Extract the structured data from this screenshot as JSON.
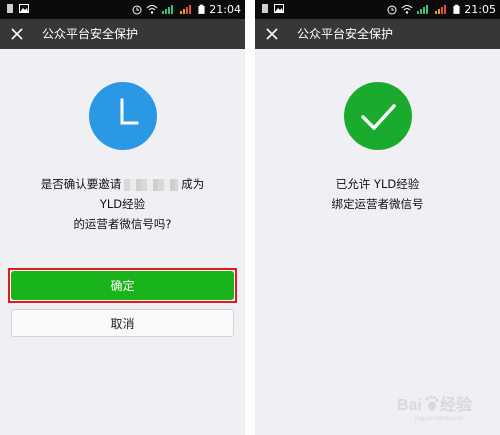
{
  "screens": [
    {
      "status_time": "21:04",
      "title": "公众平台安全保护",
      "icon": "clock-icon",
      "icon_color": "#2b98e6",
      "message_part1": "是否确认要邀请",
      "message_part2": "成为",
      "message_line2": "YLD经验",
      "message_line3": "的运营者微信号吗?",
      "confirm_label": "确定",
      "cancel_label": "取消"
    },
    {
      "status_time": "21:05",
      "title": "公众平台安全保护",
      "icon": "checkmark-icon",
      "icon_color": "#1aab2e",
      "message_line1": "已允许 YLD经验",
      "message_line2": "绑定运营者微信号"
    }
  ],
  "colors": {
    "primary_green": "#19b41c",
    "highlight_red": "#e21b23",
    "nav_bg": "#373737"
  },
  "watermark": {
    "brand": "Baidu",
    "subtitle": "经验",
    "url": "jingyan.baidu.com"
  }
}
